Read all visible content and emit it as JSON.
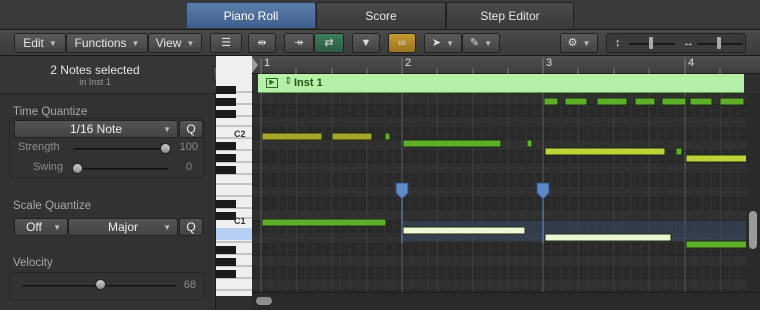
{
  "tabs": [
    {
      "label": "Piano Roll",
      "active": true
    },
    {
      "label": "Score",
      "active": false
    },
    {
      "label": "Step Editor",
      "active": false
    }
  ],
  "toolbar": {
    "edit_label": "Edit",
    "functions_label": "Functions",
    "view_label": "View",
    "icons": [
      "catch-icon",
      "midi-in-icon",
      "midi-out-icon",
      "green-midi-icon",
      "filter-icon",
      "link-icon",
      "pointer-tool-icon",
      "pencil-tool-icon",
      "gear-icon",
      "vertical-zoom-icon",
      "horizontal-zoom-icon"
    ]
  },
  "inspector": {
    "selection_title": "2 Notes selected",
    "selection_subtitle": "in Inst 1",
    "time_quantize": {
      "label": "Time Quantize",
      "value": "1/16 Note",
      "q_label": "Q",
      "strength_label": "Strength",
      "strength_value": "100",
      "swing_label": "Swing",
      "swing_value": "0"
    },
    "scale_quantize": {
      "label": "Scale Quantize",
      "mode_value": "Off",
      "scale_value": "Major",
      "q_label": "Q"
    },
    "velocity": {
      "label": "Velocity",
      "value": "68"
    }
  },
  "keyboard": {
    "c2_label": "C2",
    "c1_label": "C1"
  },
  "ruler": {
    "bars": [
      "1",
      "2",
      "3",
      "4"
    ]
  },
  "region": {
    "name": "Inst 1"
  },
  "colors": {
    "accent_tab": "#4f6f9c",
    "region_bg": "#b6f0a8",
    "note_green": "#5fae2a",
    "note_olive": "#a6a62a",
    "note_yellow_green": "#bcd43a",
    "note_selected": "#e9f7d4",
    "selection_marker": "#5f89c7"
  }
}
